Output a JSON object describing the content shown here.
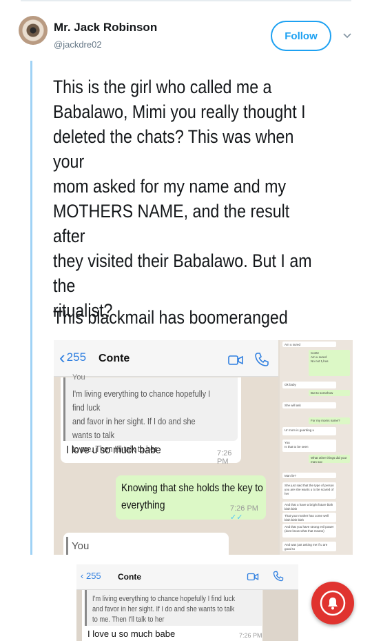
{
  "tweet": {
    "author_name": "Mr. Jack Robinson",
    "author_handle": "@jackdre02",
    "follow_label": "Follow",
    "text": "This is the girl who called me a\nBabalawo, Mimi you really thought I\ndeleted the chats? This was when your\nmom asked for my name and my\nMOTHERS NAME, and the result after\nthey visited their Babalawo. But I am the\nritualist?",
    "text2": "This blackmail has boomeranged"
  },
  "chat": {
    "back_count": "255",
    "contact_name": "Conte",
    "quote_label": "You",
    "quote_text": "I'm living everything to chance hopefully I find luck\nand favor in her sight. If I do and she wants to talk\nto me. Then I'll talk to her",
    "incoming_text": "I love u so much babe",
    "incoming_time": "7:26 PM",
    "outgoing_text": "Knowing that she holds the key to\neverything",
    "outgoing_time": "7:26 PM",
    "reply_label": "You"
  },
  "side_chat": {
    "messages": [
      {
        "text": "Am u sured",
        "dir": "in"
      },
      {
        "text": "Conte\nAm u sured\nNo not 1,hus",
        "dir": "out"
      },
      {
        "text": "Ok baby",
        "dir": "in"
      },
      {
        "text": "But to somehow",
        "dir": "out"
      },
      {
        "text": "She will ask",
        "dir": "in"
      },
      {
        "text": "For my moms name?",
        "dir": "out"
      },
      {
        "text": "Ur mom is guarding u",
        "dir": "in"
      },
      {
        "text": "You\nIs that to be seen",
        "dir": "in"
      },
      {
        "text": "What other things did your man say",
        "dir": "out"
      },
      {
        "text": "Man lie?",
        "dir": "in"
      },
      {
        "text": "She just said that the type of person you are she wants u to be scared of her",
        "dir": "in"
      },
      {
        "text": "And that u have a bright future blah blah blah",
        "dir": "in"
      },
      {
        "text": "That your mother has come well blah blah blah",
        "dir": "in"
      },
      {
        "text": "And that you have strong evil power (dont know what that means)",
        "dir": "in"
      },
      {
        "text": "And was just asking me if u are good to",
        "dir": "in"
      }
    ]
  },
  "second_image": {
    "back_count": "255",
    "contact_name": "Conte",
    "quote_text": "I'm living everything to chance hopefully I find luck\nand favor in her sight. If I do and she wants to talk\nto me. Then I'll talk to her",
    "incoming_text": "I love u so much babe",
    "incoming_time": "7:26 PM"
  },
  "colors": {
    "accent": "#1da1f2",
    "thread_line": "#9fd2f5",
    "notify": "#e0332f",
    "outgoing_bubble": "#dcf8c6"
  }
}
